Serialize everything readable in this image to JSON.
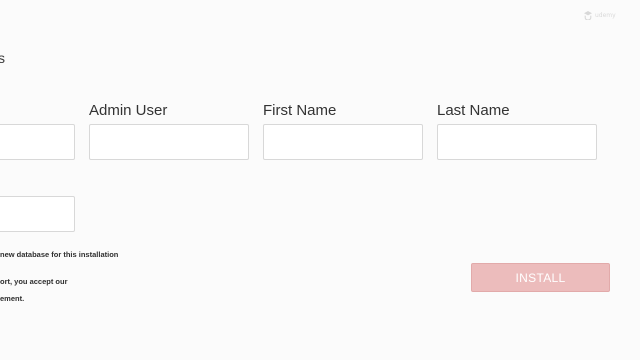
{
  "heading": {
    "fragment": "s"
  },
  "fields": {
    "admin_user_label": "Admin User",
    "first_name_label": "First Name",
    "last_name_label": "Last Name",
    "admin_user_value": "",
    "first_name_value": "",
    "last_name_value": ""
  },
  "fine_print": {
    "line1": "new database for this installation",
    "line2": "ort, you accept our",
    "line3": "ement."
  },
  "install_button": {
    "label": "INSTALL"
  },
  "watermark": {
    "text": "udemy",
    "icon": "udemy-logo-icon"
  },
  "colors": {
    "install_button_bg": "#ecbcbc",
    "background": "#fbfbfb",
    "input_border": "#d8d8d8"
  }
}
